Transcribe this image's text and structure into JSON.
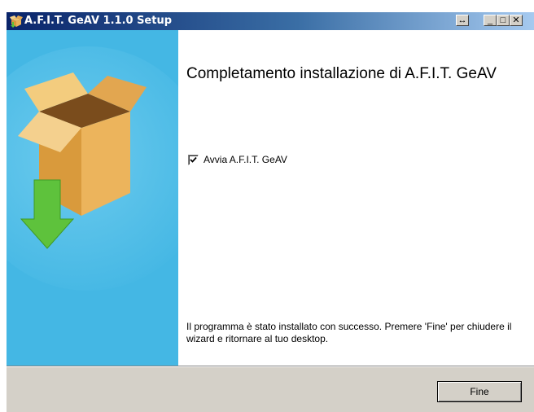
{
  "window": {
    "title": "A.F.I.T. GeAV 1.1.0 Setup"
  },
  "titlebar_buttons": {
    "resize": "↔",
    "minimize": "_",
    "maximize": "□",
    "close": "✕"
  },
  "content": {
    "heading": "Completamento installazione di A.F.I.T. GeAV",
    "checkbox": {
      "label": "Avvia A.F.I.T. GeAV",
      "checked": true
    },
    "message": "Il programma è stato installato con successo. Premere 'Fine' per chiudere il wizard e ritornare al tuo desktop."
  },
  "footer": {
    "finish_label": "Fine"
  },
  "icons": {
    "app": "box-install-icon",
    "sidebar": "box-download-icon"
  },
  "colors": {
    "sidebar": "#44b7e4",
    "titlebar_start": "#0a246a",
    "titlebar_end": "#a6caf0",
    "arrow": "#5ec23c"
  }
}
